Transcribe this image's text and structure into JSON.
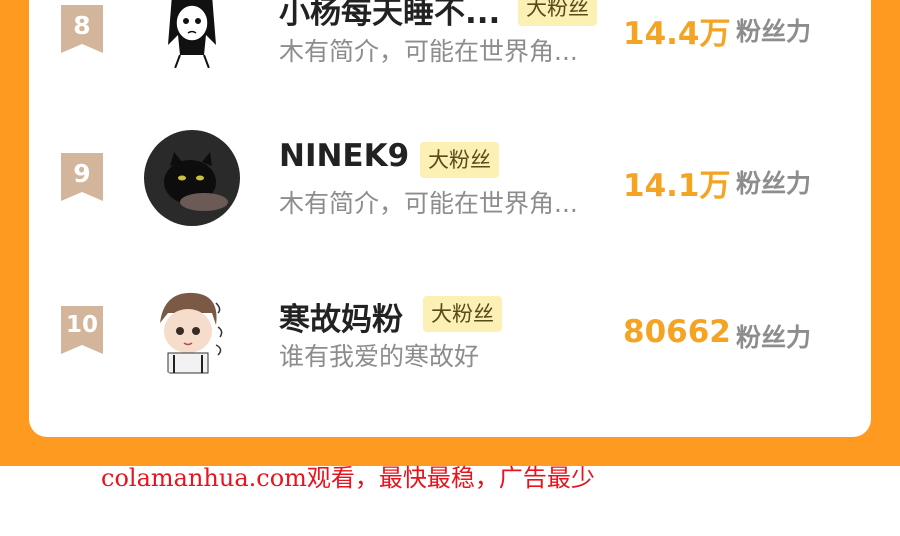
{
  "ranking": {
    "rows": [
      {
        "rank": "8",
        "name": "小杨每天睡不...",
        "badge": "大粉丝",
        "bio": "木有简介，可能在世界角...",
        "fans_value": "14.4万",
        "fans_label": "粉丝力"
      },
      {
        "rank": "9",
        "name": "NINEK9",
        "badge": "大粉丝",
        "bio": "木有简介，可能在世界角...",
        "fans_value": "14.1万",
        "fans_label": "粉丝力"
      },
      {
        "rank": "10",
        "name": "寒故妈粉",
        "badge": "大粉丝",
        "bio": "谁有我爱的寒故好",
        "fans_value": "80662",
        "fans_label": "粉丝力"
      }
    ]
  },
  "colors": {
    "background_orange": "#fd9a1f",
    "rank_badge": "#d2b59a",
    "fans_value": "#f4a422",
    "badge_bg": "#fdf0b4",
    "watermark": "#e8131c"
  },
  "watermark": {
    "text": "colamanhua.com观看，最快最稳，广告最少"
  }
}
